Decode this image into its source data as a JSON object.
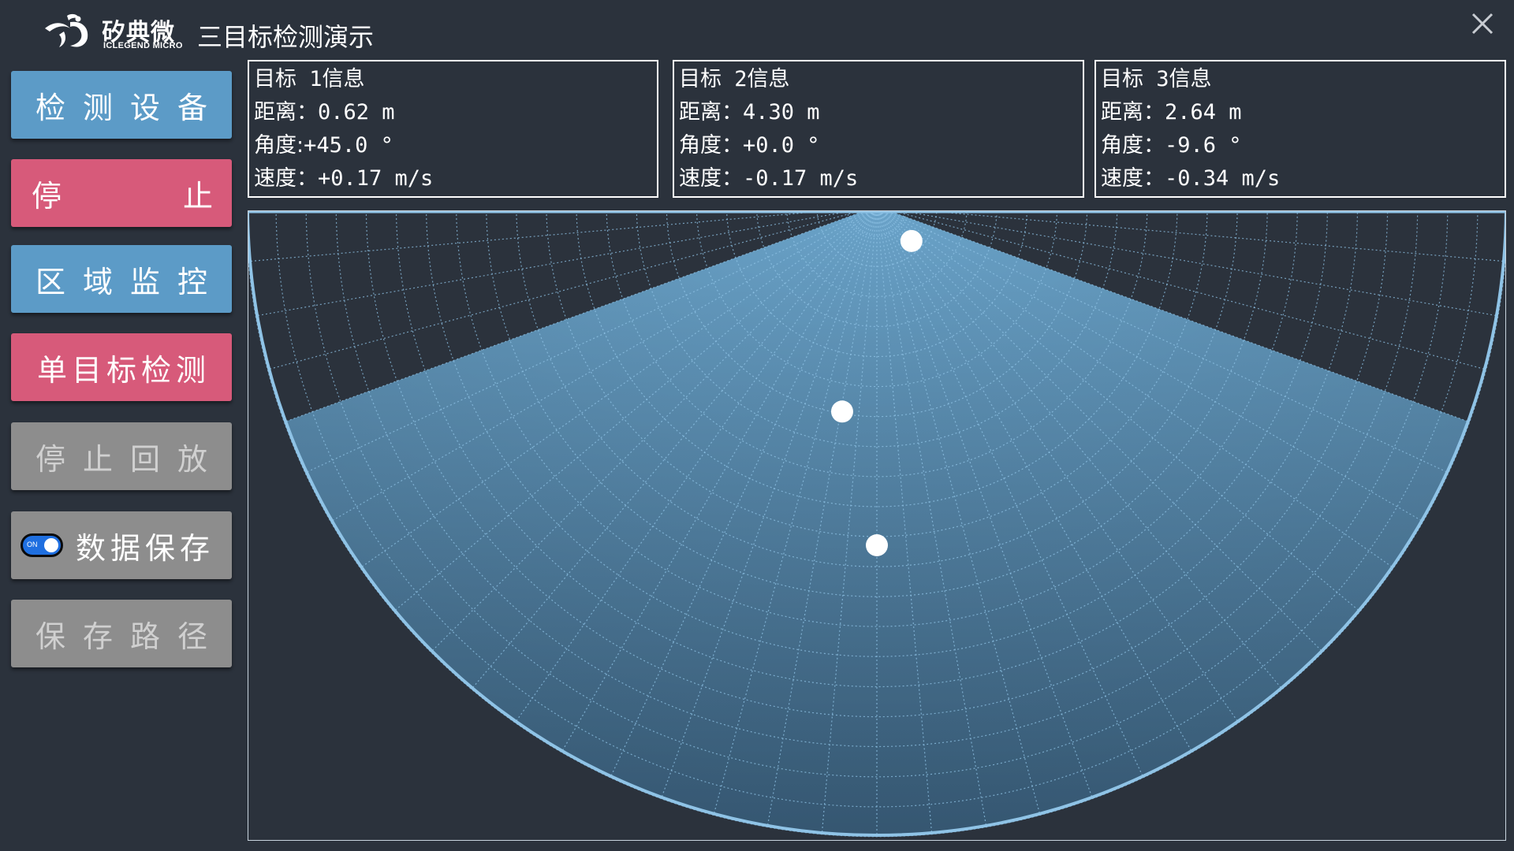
{
  "header": {
    "logo_cn": "矽典微",
    "logo_en": "ICLEGEND MICRO",
    "title": "三目标检测演示"
  },
  "sidebar": {
    "detect_device": "检测设备",
    "stop": {
      "left": "停",
      "right": "止"
    },
    "area_monitor": "区域监控",
    "single_target": "单目标检测",
    "stop_playback": "停止回放",
    "data_save": {
      "toggle_text": "ON",
      "toggle_state": "on",
      "label": "数据保存"
    },
    "save_path": "保存路径"
  },
  "targets": [
    {
      "title": "目标 1信息",
      "distance_key": "距离：",
      "distance": "0.62 m",
      "angle_key": "角度:",
      "angle": "+45.0 °",
      "speed_key": "速度：",
      "speed": "+0.17 m/s"
    },
    {
      "title": "目标 2信息",
      "distance_key": "距离：",
      "distance": "4.30 m",
      "angle_key": "角度：",
      "angle": "+0.0 °",
      "speed_key": "速度：",
      "speed": "-0.17 m/s"
    },
    {
      "title": "目标 3信息",
      "distance_key": "距离：",
      "distance": "2.64 m",
      "angle_key": "角度：",
      "angle": "-9.6 °",
      "speed_key": "速度：",
      "speed": "-0.34 m/s"
    }
  ],
  "radar": {
    "field_of_view_deg": 140,
    "sector_color": "#6aa3c9",
    "background_color": "#2b323c",
    "grid_color": "#8fc3e6",
    "outline_color": "#8fc3e6",
    "ring_count": 21,
    "spoke_step_deg": 5,
    "target_color": "#ffffff"
  },
  "colors": {
    "blue_button": "#5c9bc7",
    "pink_button": "#d75a7a",
    "gray_button": "#8d8d8d",
    "toggle_on": "#1f6fe0"
  }
}
